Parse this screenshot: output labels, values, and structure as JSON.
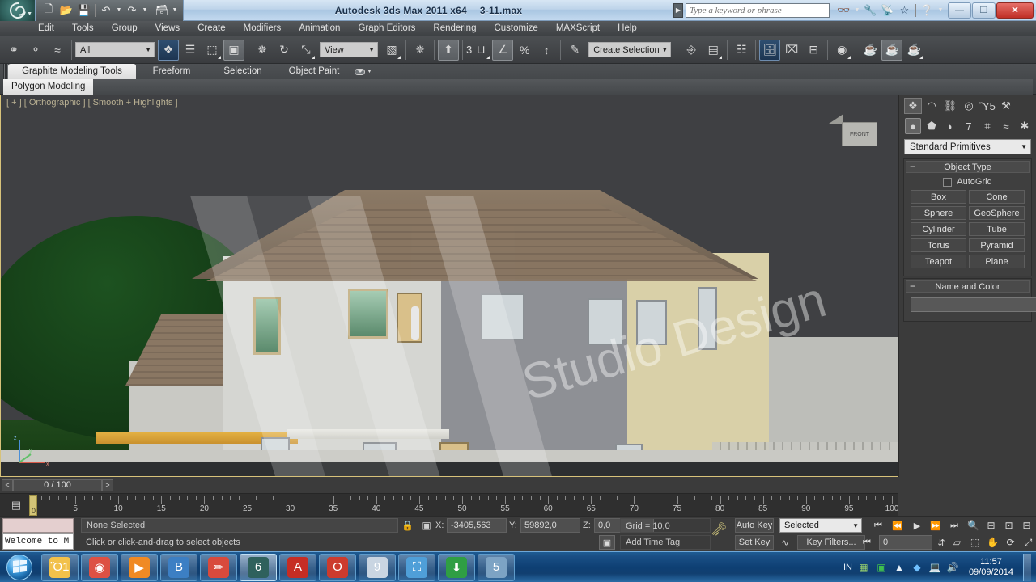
{
  "window": {
    "app_title": "Autodesk 3ds Max  2011 x64",
    "file_name": "3-11.max",
    "app_menu_icon": "3dsmax-logo-icon",
    "minimize_label": "—",
    "restore_label": "❐",
    "close_label": "✕"
  },
  "quick_access": [
    {
      "name": "new-file",
      "glyph": "□"
    },
    {
      "name": "open-file",
      "glyph": "Ὄ2"
    },
    {
      "name": "save-file",
      "glyph": "ὋE"
    },
    {
      "name": "undo",
      "glyph": "↶"
    },
    {
      "name": "redo",
      "glyph": "↷"
    },
    {
      "name": "set-project-folder",
      "glyph": "὜2"
    }
  ],
  "search": {
    "placeholder": "Type a keyword or phrase",
    "icons": [
      "binoculars-icon",
      "wrench-icon",
      "satellite-icon",
      "star-icon",
      "help-icon"
    ]
  },
  "menu": {
    "items": [
      "Edit",
      "Tools",
      "Group",
      "Views",
      "Create",
      "Modifiers",
      "Animation",
      "Graph Editors",
      "Rendering",
      "Customize",
      "MAXScript",
      "Help"
    ]
  },
  "toolbar": {
    "selection_filter": "All",
    "reference_coord": "View",
    "named_selection_sets": "Create Selection Se",
    "angle_snap_count": "3",
    "buttons": [
      {
        "name": "select-link-button",
        "glyph": "⚭"
      },
      {
        "name": "unlink-selection-button",
        "glyph": "⚬"
      },
      {
        "name": "bind-to-space-warp-button",
        "glyph": "≈"
      },
      {
        "name": "select-object-button",
        "glyph": "❖"
      },
      {
        "name": "select-by-name-button",
        "glyph": "☰"
      },
      {
        "name": "rectangular-selection-region-button",
        "glyph": "⬚"
      },
      {
        "name": "window-crossing-toggle-button",
        "glyph": "▣"
      },
      {
        "name": "select-and-move-button",
        "glyph": "✥"
      },
      {
        "name": "select-and-rotate-button",
        "glyph": "↻"
      },
      {
        "name": "select-and-scale-button",
        "glyph": "⤡"
      },
      {
        "name": "use-center-flyout-button",
        "glyph": "▧"
      },
      {
        "name": "select-and-manipulate-button",
        "glyph": "✵"
      },
      {
        "name": "snaps-toggle-button",
        "glyph": "⊓"
      },
      {
        "name": "angle-snap-toggle-button",
        "glyph": "∠"
      },
      {
        "name": "percent-snap-toggle-button",
        "glyph": "%"
      },
      {
        "name": "spinner-snap-toggle-button",
        "glyph": "↕"
      },
      {
        "name": "edit-named-selection-sets-button",
        "glyph": "✎"
      },
      {
        "name": "mirror-button",
        "glyph": "⬌"
      },
      {
        "name": "align-button",
        "glyph": "⌸"
      },
      {
        "name": "layer-manager-button",
        "glyph": "❐"
      },
      {
        "name": "toggle-scene-explorer-button",
        "glyph": "὜4"
      },
      {
        "name": "curve-editor-button",
        "glyph": "⌇"
      },
      {
        "name": "schematic-view-button",
        "glyph": "≡"
      },
      {
        "name": "material-editor-button",
        "glyph": "◉"
      },
      {
        "name": "render-setup-button",
        "glyph": "☕"
      },
      {
        "name": "rendered-frame-window-button",
        "glyph": "☕"
      },
      {
        "name": "render-production-button",
        "glyph": "☕"
      }
    ]
  },
  "ribbon": {
    "tabs": [
      {
        "name": "tab-graphite-modeling-tools",
        "label": "Graphite Modeling Tools",
        "selected": true
      },
      {
        "name": "tab-freeform",
        "label": "Freeform",
        "selected": false
      },
      {
        "name": "tab-selection",
        "label": "Selection",
        "selected": false
      },
      {
        "name": "tab-object-paint",
        "label": "Object Paint",
        "selected": false
      }
    ],
    "panel_label": "Polygon Modeling",
    "minimize_icon": "ribbon-minimize-icon"
  },
  "viewport": {
    "label": "[ + ] [ Orthographic ] [ Smooth + Highlights ]",
    "watermark_text": "Studio Design",
    "viewcube_face": "FRONT",
    "axis_labels": {
      "x": "x",
      "y": "y",
      "z": "z"
    }
  },
  "command_panel": {
    "tabs": [
      {
        "name": "cp-tab-create",
        "glyph": "❖",
        "selected": true
      },
      {
        "name": "cp-tab-modify",
        "glyph": "◠",
        "selected": false
      },
      {
        "name": "cp-tab-hierarchy",
        "glyph": "⛓",
        "selected": false
      },
      {
        "name": "cp-tab-motion",
        "glyph": "◎",
        "selected": false
      },
      {
        "name": "cp-tab-display",
        "glyph": "Ὓ5",
        "selected": false
      },
      {
        "name": "cp-tab-utilities",
        "glyph": "⚒",
        "selected": false
      }
    ],
    "categories": [
      {
        "name": "category-geometry",
        "glyph": "●",
        "selected": true
      },
      {
        "name": "category-shapes",
        "glyph": "⬟",
        "selected": false
      },
      {
        "name": "category-lights",
        "glyph": "◗",
        "selected": false
      },
      {
        "name": "category-cameras",
        "glyph": "὏7",
        "selected": false
      },
      {
        "name": "category-helpers",
        "glyph": "⌗",
        "selected": false
      },
      {
        "name": "category-space-warps",
        "glyph": "≈",
        "selected": false
      },
      {
        "name": "category-systems",
        "glyph": "✱",
        "selected": false
      }
    ],
    "dropdown_value": "Standard Primitives",
    "object_type": {
      "title": "Object Type",
      "autogrid_label": "AutoGrid",
      "autogrid_checked": false,
      "buttons": [
        "Box",
        "Cone",
        "Sphere",
        "GeoSphere",
        "Cylinder",
        "Tube",
        "Torus",
        "Pyramid",
        "Teapot",
        "Plane"
      ]
    },
    "name_and_color": {
      "title": "Name and Color",
      "name_value": "",
      "color": "#b51a4a"
    }
  },
  "timeline": {
    "slider_label": "0 / 100",
    "prev_frame": "<",
    "next_frame": ">",
    "ruler_ticks": [
      0,
      5,
      10,
      15,
      20,
      25,
      30,
      35,
      40,
      45,
      50,
      55,
      60,
      65,
      70,
      75,
      80,
      85,
      90,
      95,
      100
    ],
    "ruler_min": 0,
    "ruler_max": 100,
    "current_frame": 0
  },
  "status_bar": {
    "maxscript_listener": "Welcome to M",
    "selection_status": "None Selected",
    "prompt": "Click or click-and-drag to select objects",
    "lock_icon": "lock-icon",
    "transform_icon": "transform-type-in-icon",
    "coordinates": [
      {
        "axis": "X:",
        "value": "-3405,563"
      },
      {
        "axis": "Y:",
        "value": "59892,0"
      },
      {
        "axis": "Z:",
        "value": "0,0"
      }
    ],
    "grid_label": "Grid = 10,0",
    "add_time_tag": "Add Time Tag"
  },
  "animation": {
    "auto_key": "Auto Key",
    "set_key": "Set Key",
    "key_mode": "Selected",
    "key_filters": "Key Filters...",
    "frame_value": "0",
    "playback_buttons": [
      {
        "name": "go-to-start-button",
        "glyph": "⏮"
      },
      {
        "name": "previous-frame-button",
        "glyph": "⏴"
      },
      {
        "name": "play-animation-button",
        "glyph": "▶"
      },
      {
        "name": "next-frame-button",
        "glyph": "⏵"
      },
      {
        "name": "go-to-end-button",
        "glyph": "⏭"
      }
    ],
    "key_mode_toggle": "⏭⏮"
  },
  "navigation": {
    "buttons": [
      {
        "name": "zoom-button",
        "glyph": "ὐD"
      },
      {
        "name": "zoom-all-button",
        "glyph": "⊞"
      },
      {
        "name": "zoom-extents-button",
        "glyph": "⊡"
      },
      {
        "name": "zoom-extents-all-button",
        "glyph": "⊟"
      },
      {
        "name": "field-of-view-button",
        "glyph": "◱"
      },
      {
        "name": "zoom-region-button",
        "glyph": "⬚"
      },
      {
        "name": "pan-view-button",
        "glyph": "✋"
      },
      {
        "name": "orbit-button",
        "glyph": "⟳"
      },
      {
        "name": "maximize-viewport-toggle-button",
        "glyph": "⤢"
      }
    ]
  },
  "taskbar": {
    "start_label": "start-orb-icon",
    "items": [
      {
        "name": "taskbar-windows-explorer",
        "glyph": "Ὄ1",
        "color": "#f2c14a",
        "active": false
      },
      {
        "name": "taskbar-google-chrome",
        "glyph": "◉",
        "color": "#dd5144",
        "active": false
      },
      {
        "name": "taskbar-media-player",
        "glyph": "▶",
        "color": "#f08a24",
        "active": false
      },
      {
        "name": "taskbar-feather-editor",
        "glyph": "὘B",
        "color": "#3c7fc4",
        "active": false
      },
      {
        "name": "taskbar-paint",
        "glyph": "✏",
        "color": "#d84a3c",
        "active": false
      },
      {
        "name": "taskbar-3ds-max",
        "glyph": "6",
        "color": "#2f615d",
        "active": true
      },
      {
        "name": "taskbar-autocad",
        "glyph": "A",
        "color": "#c62d24",
        "active": false
      },
      {
        "name": "taskbar-opera",
        "glyph": "O",
        "color": "#cc3b2e",
        "active": false
      },
      {
        "name": "taskbar-calculator",
        "glyph": "὚9",
        "color": "#c9d5e2",
        "active": false
      },
      {
        "name": "taskbar-network",
        "glyph": "⛶",
        "color": "#4f9fd8",
        "active": false
      },
      {
        "name": "taskbar-idm-downloader",
        "glyph": "⬇",
        "color": "#2f9e44",
        "active": false
      },
      {
        "name": "taskbar-system-monitor",
        "glyph": "὚5",
        "color": "#7da3c4",
        "active": false
      }
    ],
    "tray": {
      "language": "IN",
      "icons": [
        "tray-keyboard-icon",
        "tray-green-icon",
        "tray-network-icon",
        "tray-bluetooth-icon",
        "tray-display-icon",
        "tray-volume-icon"
      ],
      "time": "11:57",
      "date": "09/09/2014"
    }
  }
}
